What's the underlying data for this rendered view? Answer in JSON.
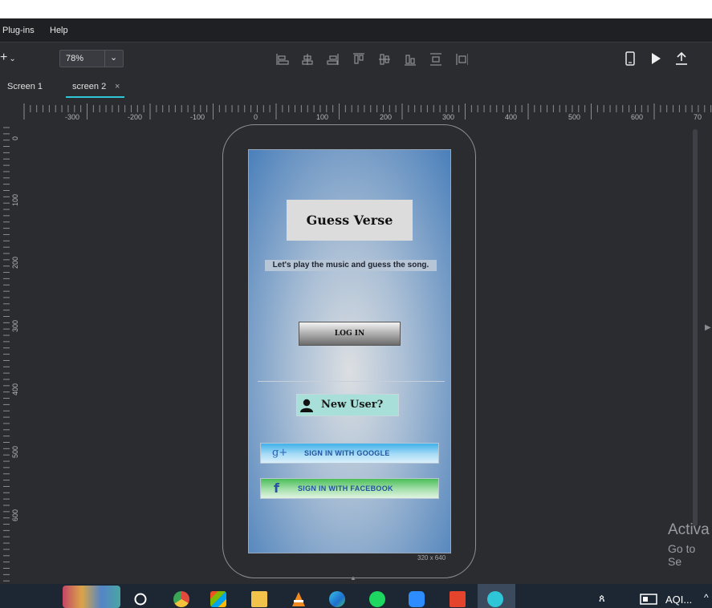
{
  "menu": {
    "items": [
      "Plug-ins",
      "Help"
    ]
  },
  "toolbar": {
    "zoom": "78%",
    "add_label": "+"
  },
  "tabs": [
    {
      "label": "Screen 1"
    },
    {
      "label": "screen 2",
      "close": "×"
    }
  ],
  "ruler": {
    "h": [
      "-300",
      "-200",
      "-100",
      "0",
      "100",
      "200",
      "300",
      "400",
      "500",
      "600",
      "70"
    ],
    "v": [
      "0",
      "100",
      "200",
      "300",
      "400",
      "500",
      "600"
    ]
  },
  "app": {
    "title": "Guess Verse",
    "tagline": "Let's play the music and guess the song.",
    "login_label": "LOG IN",
    "new_user_label": "New User?",
    "google_glyph": "g+",
    "google_label": "SIGN IN WITH GOOGLE",
    "facebook_glyph": "f",
    "facebook_label": "SIGN IN WITH FACEBOOK"
  },
  "canvas": {
    "size_label": "320 x 640",
    "activate_1": "Activa",
    "activate_2": "Go to Se"
  },
  "taskbar": {
    "aqi_label": "AQI..."
  },
  "colors": {
    "accent": "#2fc6d8",
    "google": "#6fbfe8",
    "facebook": "#5cc46a",
    "title_bg": "#dcdcdc"
  }
}
